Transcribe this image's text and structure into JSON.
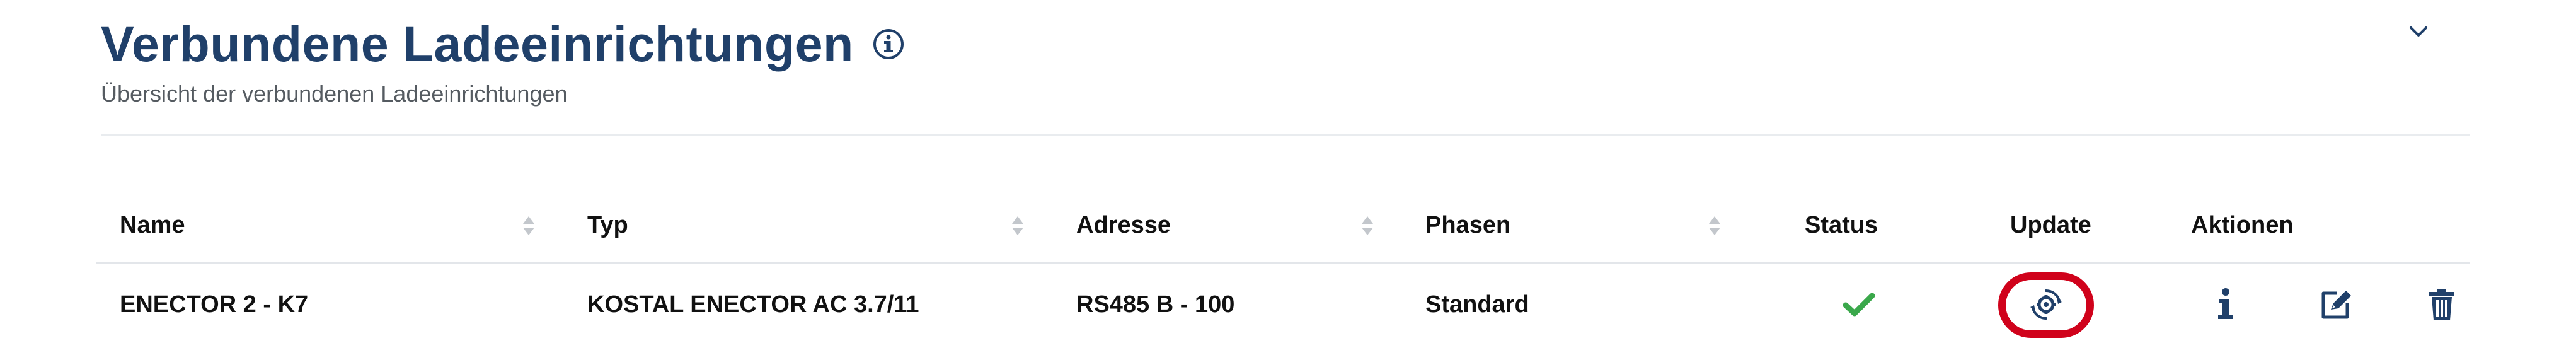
{
  "header": {
    "title": "Verbundene Ladeeinrichtungen",
    "info_icon": "info-circle-icon",
    "subtitle": "Übersicht der verbundenen Ladeeinrichtungen",
    "collapse_icon": "chevron-down-icon"
  },
  "table": {
    "columns": [
      {
        "label": "Name",
        "sortable": true
      },
      {
        "label": "Typ",
        "sortable": true
      },
      {
        "label": "Adresse",
        "sortable": true
      },
      {
        "label": "Phasen",
        "sortable": true
      },
      {
        "label": "Status",
        "sortable": false
      },
      {
        "label": "Update",
        "sortable": false
      },
      {
        "label": "Aktionen",
        "sortable": false
      }
    ],
    "rows": [
      {
        "name": "ENECTOR 2 - K7",
        "typ": "KOSTAL ENECTOR AC 3.7/11",
        "adresse": "RS485 B - 100",
        "phasen": "Standard",
        "status_icon": "checkmark-icon",
        "update_icon": "update-gear-icon",
        "actions": [
          "info-icon",
          "edit-icon",
          "delete-icon"
        ]
      }
    ]
  },
  "colors": {
    "title": "#20406a",
    "status_ok": "#3aa84b",
    "icon_dark": "#20406a",
    "highlight": "#d0021b"
  }
}
